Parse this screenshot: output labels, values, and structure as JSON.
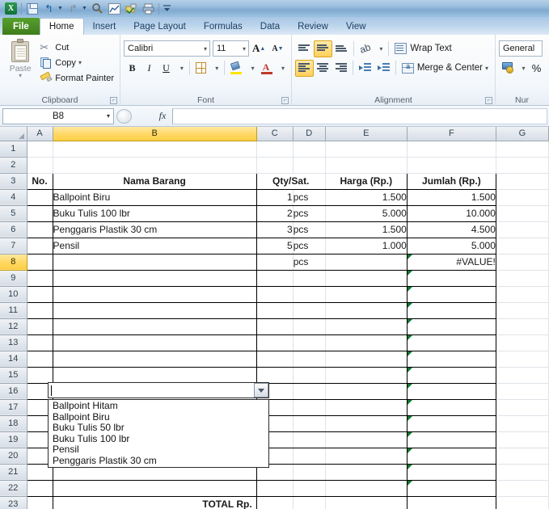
{
  "app": {
    "quick_access": [
      {
        "name": "excel-logo",
        "glyph": "X"
      },
      {
        "name": "save-icon",
        "glyph": ""
      },
      {
        "name": "undo-icon",
        "glyph": "↰"
      },
      {
        "name": "redo-icon",
        "glyph": "↱"
      },
      {
        "name": "print-preview-icon",
        "glyph": ""
      },
      {
        "name": "chart-icon",
        "glyph": ""
      },
      {
        "name": "spelling-icon",
        "glyph": ""
      },
      {
        "name": "quick-print-icon",
        "glyph": ""
      },
      {
        "name": "customize-qat-icon",
        "glyph": "▾"
      }
    ]
  },
  "ribbon": {
    "tabs": [
      {
        "label": "File",
        "state": "file"
      },
      {
        "label": "Home",
        "state": "active"
      },
      {
        "label": "Insert",
        "state": "normal"
      },
      {
        "label": "Page Layout",
        "state": "normal"
      },
      {
        "label": "Formulas",
        "state": "normal"
      },
      {
        "label": "Data",
        "state": "normal"
      },
      {
        "label": "Review",
        "state": "normal"
      },
      {
        "label": "View",
        "state": "normal"
      }
    ],
    "clipboard": {
      "group_label": "Clipboard",
      "paste_label": "Paste",
      "cut_label": "Cut",
      "copy_label": "Copy",
      "format_painter_label": "Format Painter"
    },
    "font": {
      "group_label": "Font",
      "font_name": "Calibri",
      "font_size": "11",
      "grow_font_label": "A",
      "shrink_font_label": "A",
      "bold_label": "B",
      "italic_label": "I",
      "underline_label": "U"
    },
    "alignment": {
      "group_label": "Alignment",
      "wrap_text_label": "Wrap Text",
      "merge_center_label": "Merge & Center"
    },
    "number": {
      "group_label": "Nur",
      "format_value": "General",
      "percent_label": "%"
    }
  },
  "formula_bar": {
    "name_box_value": "B8",
    "formula_value": "",
    "fx_label": "fx"
  },
  "sheet": {
    "columns": [
      "A",
      "B",
      "C",
      "D",
      "E",
      "F",
      "G"
    ],
    "selected_column": "B",
    "selected_row": "8",
    "rows": [
      "1",
      "2",
      "3",
      "4",
      "5",
      "6",
      "7",
      "8",
      "9",
      "10",
      "11",
      "12",
      "13",
      "14",
      "15",
      "16",
      "17",
      "18",
      "19",
      "20",
      "21",
      "22",
      "23"
    ],
    "header_row": {
      "no": "No.",
      "nama_barang": "Nama Barang",
      "qty_sat": "Qty/Sat.",
      "harga": "Harga (Rp.)",
      "jumlah": "Jumlah (Rp.)"
    },
    "items": [
      {
        "no": "",
        "nama": "Ballpoint Biru",
        "qty": "1",
        "sat": "pcs",
        "harga": "1.500",
        "jumlah": "1.500"
      },
      {
        "no": "",
        "nama": "Buku Tulis 100 lbr",
        "qty": "2",
        "sat": "pcs",
        "harga": "5.000",
        "jumlah": "10.000"
      },
      {
        "no": "",
        "nama": "Penggaris Plastik 30 cm",
        "qty": "3",
        "sat": "pcs",
        "harga": "1.500",
        "jumlah": "4.500"
      },
      {
        "no": "",
        "nama": "Pensil",
        "qty": "5",
        "sat": "pcs",
        "harga": "1.000",
        "jumlah": "5.000"
      },
      {
        "no": "",
        "nama": "",
        "qty": "",
        "sat": "pcs",
        "harga": "",
        "jumlah": "#VALUE!"
      }
    ],
    "total_label": "TOTAL Rp."
  },
  "dropdown": {
    "open": true,
    "current_value": "",
    "options": [
      "Ballpoint Hitam",
      "Ballpoint Biru",
      "Buku Tulis 50 lbr",
      "Buku Tulis 100 lbr",
      "Pensil",
      "Penggaris Plastik 30 cm"
    ]
  },
  "colors": {
    "accent": "#ffd864",
    "file_tab": "#3f7d1c",
    "error_marker": "#0a7a2e"
  }
}
